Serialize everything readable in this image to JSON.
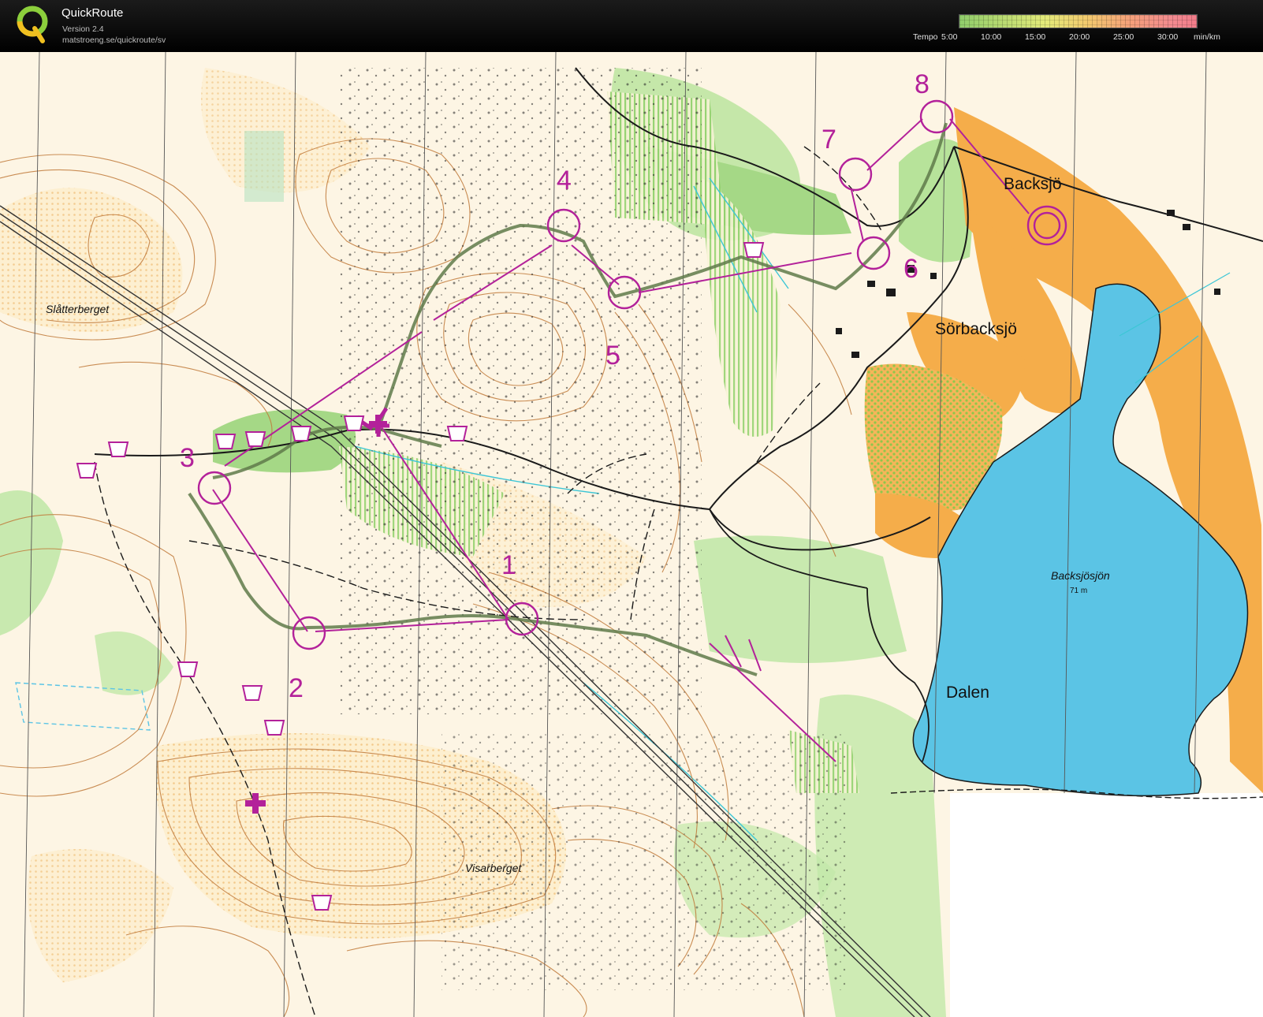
{
  "app": {
    "name": "QuickRoute",
    "version": "Version 2.4",
    "url": "matstroeng.se/quickroute/sv",
    "logo_icon": "quickroute-q-logo-icon"
  },
  "tempo_legend": {
    "label": "Tempo",
    "ticks": [
      "5:00",
      "10:00",
      "15:00",
      "20:00",
      "25:00",
      "30:00"
    ],
    "unit": "min/km"
  },
  "map": {
    "place_names": [
      {
        "text": "Backsjö",
        "style": "big"
      },
      {
        "text": "Sörbacksjö",
        "style": "big"
      },
      {
        "text": "Dalen",
        "style": "big"
      },
      {
        "text": "Slåtterberget",
        "style": "italic"
      },
      {
        "text": "Visarberget",
        "style": "italic"
      }
    ],
    "lake": {
      "name": "Backsjösjön",
      "elevation": "71 m"
    },
    "controls": [
      "1",
      "2",
      "3",
      "4",
      "5",
      "6",
      "7",
      "8"
    ],
    "colors": {
      "course_magenta": "#b3219a",
      "route_line": "#5f7a4a",
      "water_blue": "#5bc4e5",
      "open_land_orange": "#f5ad4a",
      "vegetation_green": "#a9dc8a",
      "contour_brown": "#c07a3a"
    }
  }
}
